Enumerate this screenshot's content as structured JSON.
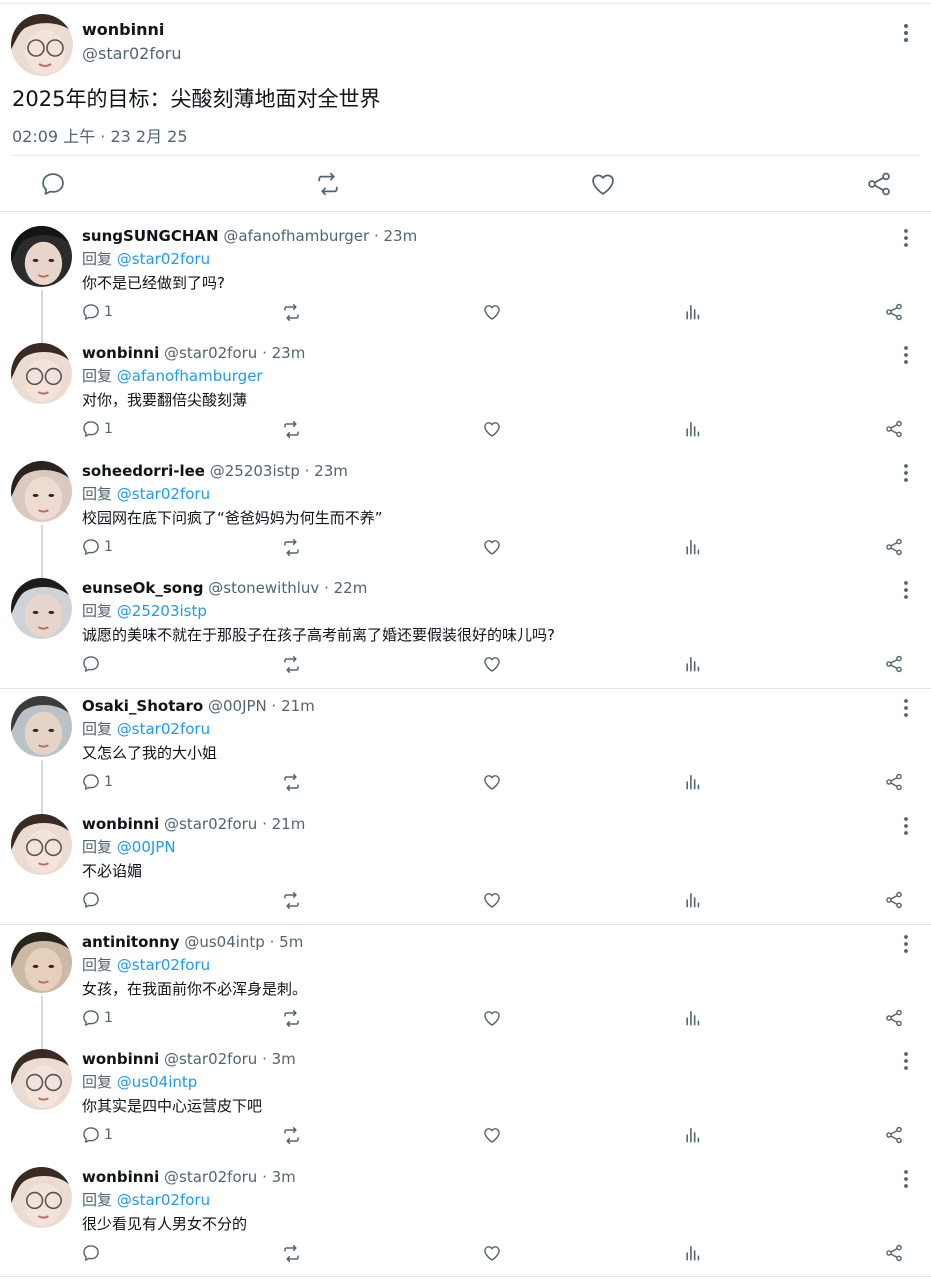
{
  "main_tweet": {
    "name": "wonbinni",
    "handle": "@star02foru",
    "text": "2025年的目标：尖酸刻薄地面对全世界",
    "timestamp": "02:09 上午 · 23 2月 25",
    "actions": [
      "reply-icon",
      "retweet-icon",
      "like-icon",
      "share-icon"
    ]
  },
  "reply_prefix": "回复",
  "replies": [
    {
      "name": "sungSUNGCHAN",
      "handle": "@afanofhamburger",
      "time": "23m",
      "reply_to": "@star02foru",
      "text": "你不是已经做到了吗?",
      "reply_count": "1"
    },
    {
      "name": "wonbinni",
      "handle": "@star02foru",
      "time": "23m",
      "reply_to": "@afanofhamburger",
      "text": "对你，我要翻倍尖酸刻薄",
      "reply_count": "1"
    },
    {
      "name": "soheedorri-lee",
      "handle": "@25203istp",
      "time": "23m",
      "reply_to": "@star02foru",
      "text": "校园网在底下问疯了“爸爸妈妈为何生而不养”",
      "reply_count": "1"
    },
    {
      "name": "eunseOk_song",
      "handle": "@stonewithluv",
      "time": "22m",
      "reply_to": "@25203istp",
      "text": "诚愿的美味不就在于那股子在孩子高考前离了婚还要假装很好的味儿吗?",
      "reply_count": ""
    },
    {
      "name": "Osaki_Shotaro",
      "handle": "@00JPN",
      "time": "21m",
      "reply_to": "@star02foru",
      "text": "又怎么了我的大小姐",
      "reply_count": "1"
    },
    {
      "name": "wonbinni",
      "handle": "@star02foru",
      "time": "21m",
      "reply_to": "@00JPN",
      "text": "不必谄媚",
      "reply_count": ""
    },
    {
      "name": "antinitonny",
      "handle": "@us04intp",
      "time": "5m",
      "reply_to": "@star02foru",
      "text": "女孩，在我面前你不必浑身是刺。",
      "reply_count": "1"
    },
    {
      "name": "wonbinni",
      "handle": "@star02foru",
      "time": "3m",
      "reply_to": "@us04intp",
      "text": "你其实是四中心运营皮下吧",
      "reply_count": "1"
    },
    {
      "name": "wonbinni",
      "handle": "@star02foru",
      "time": "3m",
      "reply_to": "@star02foru",
      "text": "很少看见有人男女不分的",
      "reply_count": ""
    }
  ],
  "colors": {
    "mention": "#1d9bf0",
    "secondary_text": "#536471",
    "primary_text": "#0f1419"
  }
}
